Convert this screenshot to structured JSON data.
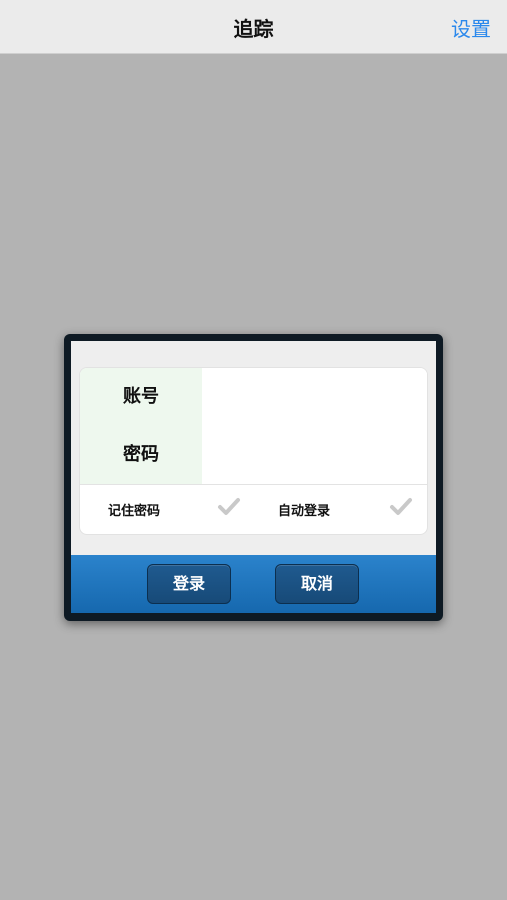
{
  "navbar": {
    "title": "追踪",
    "settings_label": "设置"
  },
  "login_dialog": {
    "fields": [
      {
        "label": "账号",
        "value": ""
      },
      {
        "label": "密码",
        "value": ""
      }
    ],
    "options": [
      {
        "label": "记住密码",
        "checked": false,
        "icon": "checkmark-icon"
      },
      {
        "label": "自动登录",
        "checked": false,
        "icon": "checkmark-icon"
      }
    ],
    "buttons": {
      "login_label": "登录",
      "cancel_label": "取消"
    }
  },
  "colors": {
    "background": "#b3b3b3",
    "navbar": "#ebebeb",
    "accent": "#2a88ec",
    "dialog_footer": "#1e74bd",
    "label_bg": "#eef8ee"
  }
}
